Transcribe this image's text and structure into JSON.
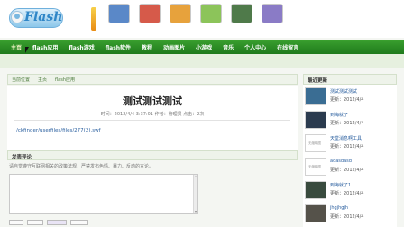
{
  "header": {
    "logo_text": "Flash",
    "games": [
      {
        "label": "",
        "color": "#5a88c8"
      },
      {
        "label": "",
        "color": "#d65a4a"
      },
      {
        "label": "",
        "color": "#e7a23c"
      },
      {
        "label": "",
        "color": "#8cc45a"
      },
      {
        "label": "",
        "color": "#4f7a4a"
      },
      {
        "label": "",
        "color": "#8a7bc6"
      }
    ]
  },
  "nav": {
    "items": [
      "主页",
      "flash应用",
      "flash游戏",
      "flash软件",
      "教程",
      "动画图片",
      "小游戏",
      "音乐",
      "个人中心",
      "在线留言"
    ]
  },
  "breadcrumb": {
    "items": [
      "当前位置",
      "主页",
      "flash应用"
    ]
  },
  "article": {
    "title": "测试测试测试",
    "meta": "时间：2012/4/4 3:37:01  作者：管理员  点击：2次",
    "link": "/ckfinder/userfiles/files/277(2).swf"
  },
  "comment": {
    "heading": "发表评论",
    "hint": "请自觉遵守互联网相关的政策法规，严禁发布色情、暴力、反动的言论。"
  },
  "sidebar": {
    "heading": "最近更新",
    "entries": [
      {
        "title": "测试测试测试",
        "date": "更新：2012/4/4",
        "thumb": "#3a6d93",
        "blank": false
      },
      {
        "title": "到海就了",
        "date": "更新：2012/4/4",
        "thumb": "#2b3b4e",
        "blank": false
      },
      {
        "title": "天堂消息啊工具",
        "date": "更新：2012/4/4",
        "thumb": "#ffffff",
        "blank": true,
        "blank_label": "无缩略图"
      },
      {
        "title": "adasdasd",
        "date": "更新：2012/4/4",
        "thumb": "#ffffff",
        "blank": true,
        "blank_label": "无缩略图"
      },
      {
        "title": "到海就了1",
        "date": "更新：2012/4/4",
        "thumb": "#394b3e",
        "blank": false
      },
      {
        "title": "jhgjhgjh",
        "date": "更新：2012/4/4",
        "thumb": "#55524a",
        "blank": false
      }
    ]
  }
}
